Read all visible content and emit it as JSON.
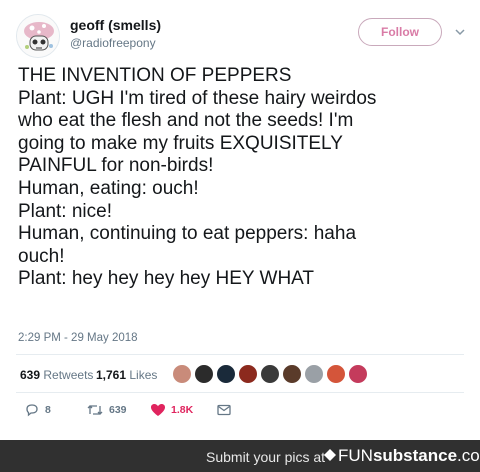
{
  "user": {
    "display_name": "geoff (smells)",
    "handle": "@radiofreepony",
    "avatar": "skull-mushroom-avatar"
  },
  "follow_label": "Follow",
  "tweet_lines": [
    "THE INVENTION OF PEPPERS",
    "Plant: UGH I'm tired of these hairy weirdos",
    "who eat the flesh and not the seeds! I'm",
    "going to make my fruits EXQUISITELY",
    "PAINFUL for non-birds!",
    "Human, eating: ouch!",
    "Plant: nice!",
    "Human, continuing to eat peppers: haha",
    "ouch!",
    "Plant: hey hey hey hey HEY WHAT"
  ],
  "timestamp": "2:29 PM - 29 May 2018",
  "stats": {
    "retweets_count": "639",
    "retweets_label": "Retweets",
    "likes_count": "1,761",
    "likes_label": "Likes"
  },
  "likers": [
    {
      "name": "liker-avatar-1",
      "color": "#c98b7a"
    },
    {
      "name": "liker-avatar-2",
      "color": "#2b2b2b"
    },
    {
      "name": "liker-avatar-3",
      "color": "#1a2a3a"
    },
    {
      "name": "liker-avatar-4",
      "color": "#8c2a1e"
    },
    {
      "name": "liker-avatar-5",
      "color": "#3a3a3a"
    },
    {
      "name": "liker-avatar-6",
      "color": "#5a3b2a"
    },
    {
      "name": "liker-avatar-7",
      "color": "#9aa0a6"
    },
    {
      "name": "liker-avatar-8",
      "color": "#d4553a"
    },
    {
      "name": "liker-avatar-9",
      "color": "#c43b5c"
    }
  ],
  "actions": {
    "reply_count": "8",
    "retweet_count": "639",
    "like_count": "1.8K"
  },
  "colors": {
    "follow_accent": "#d97ba6",
    "like_red": "#e0245e",
    "muted": "#657786",
    "footer_bg": "#303030"
  },
  "footer": {
    "text": "Submit your pics at",
    "brand_regular": "FUN",
    "brand_bold": "substance",
    "brand_suffix": ".com"
  }
}
